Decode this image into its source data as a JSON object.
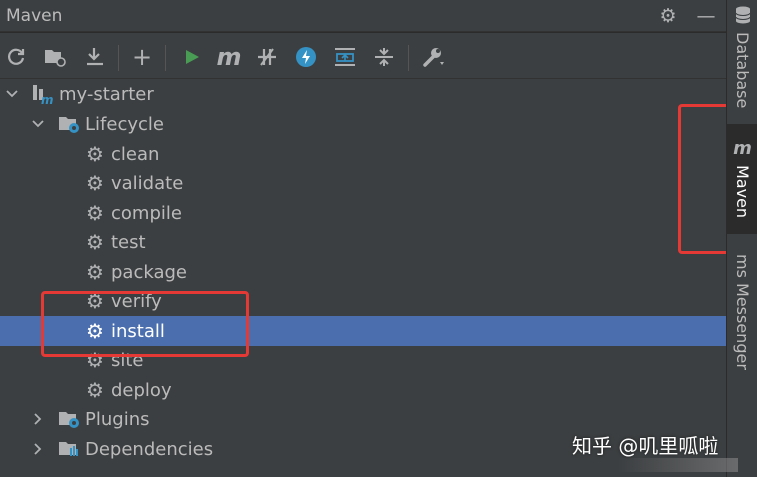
{
  "window": {
    "title": "Maven"
  },
  "toolbar": {
    "icons": [
      "reload-icon",
      "generate-sources-icon",
      "download-icon",
      "add-icon",
      "run-icon",
      "execute-goal-icon",
      "toggle-offline-icon",
      "skip-tests-icon",
      "show-dependencies-icon",
      "collapse-all-icon",
      "settings-wrench-icon"
    ],
    "add_label": "+",
    "m_label": "m"
  },
  "tree": {
    "root": {
      "label": "my-starter",
      "icon": "m"
    },
    "lifecycle": {
      "label": "Lifecycle",
      "goals": [
        "clean",
        "validate",
        "compile",
        "test",
        "package",
        "verify",
        "install",
        "site",
        "deploy"
      ],
      "selected": "install"
    },
    "plugins": {
      "label": "Plugins"
    },
    "dependencies": {
      "label": "Dependencies"
    }
  },
  "right_toolbar": {
    "tabs": [
      {
        "label": "Database"
      },
      {
        "label": "Maven",
        "icon": "m"
      },
      {
        "label": "ms Messenger"
      }
    ]
  },
  "watermark": "知乎 @叽里呱啦",
  "colors": {
    "selection": "#4b6eaf",
    "highlight_box": "#e53935",
    "run_green": "#499c54",
    "accent_blue": "#3592c4"
  }
}
